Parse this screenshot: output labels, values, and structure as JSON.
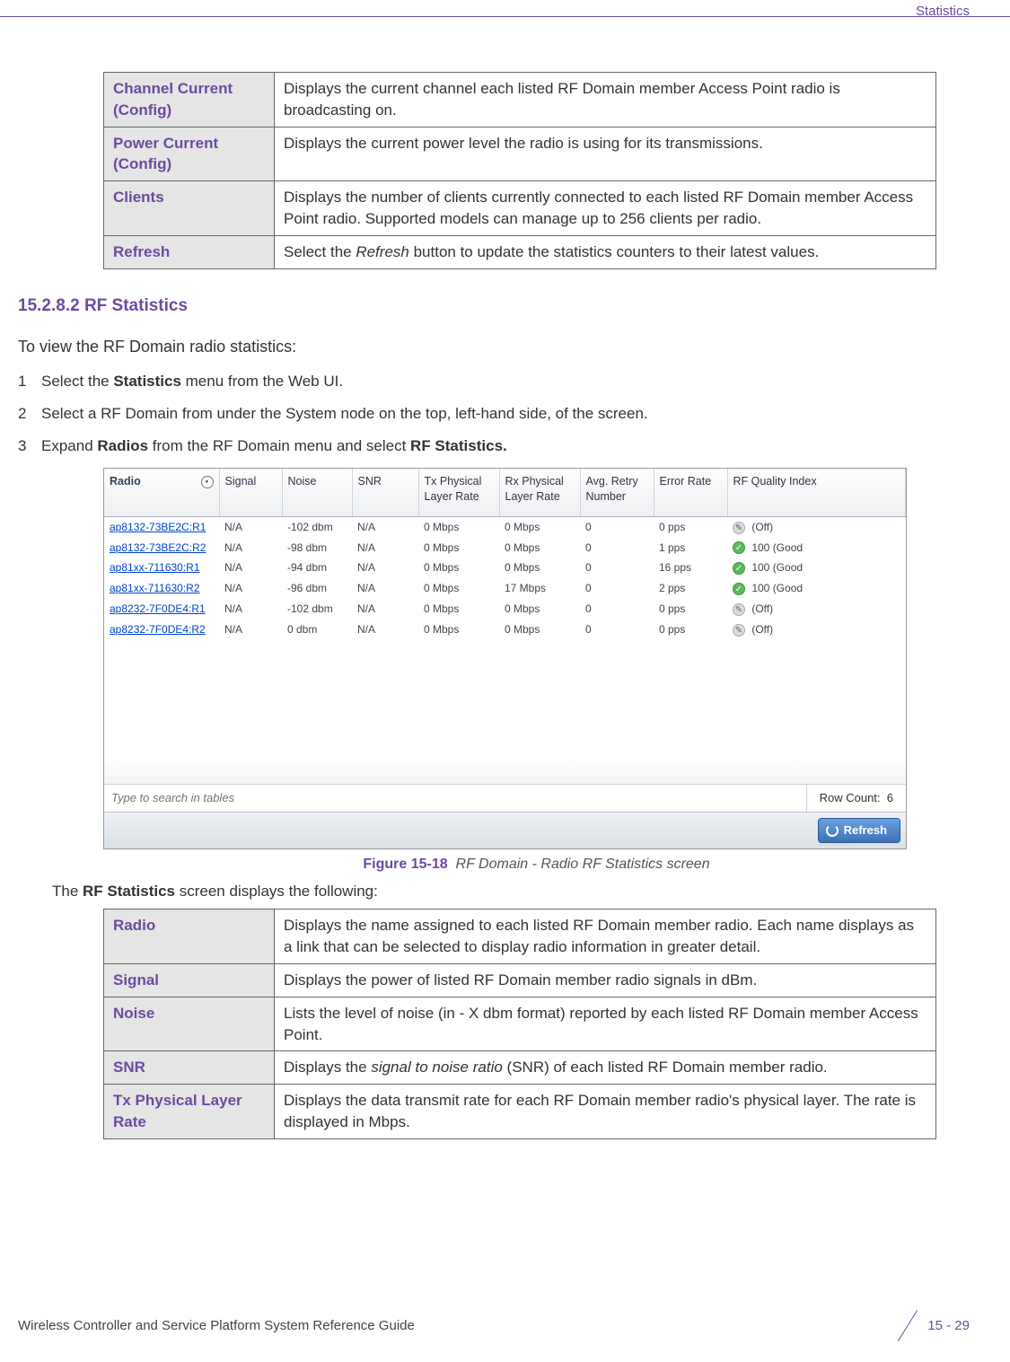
{
  "header": {
    "section_title": "Statistics"
  },
  "param_table1": [
    {
      "label": "Channel Current (Config)",
      "desc": "Displays the current channel each listed RF Domain member Access Point radio is broadcasting on."
    },
    {
      "label": "Power Current (Config)",
      "desc": "Displays the current power level the radio is using for its transmissions."
    },
    {
      "label": "Clients",
      "desc": "Displays the number of clients currently connected to each listed RF Domain member Access Point radio. Supported models can manage up to 256 clients per radio."
    },
    {
      "label": "Refresh",
      "desc_pre": "Select the ",
      "desc_em": "Refresh",
      "desc_post": " button to update the statistics counters to their latest values."
    }
  ],
  "section_heading": "15.2.8.2  RF Statistics",
  "intro": "To view the RF Domain radio statistics:",
  "steps": [
    {
      "n": "1",
      "pre": "Select the ",
      "b1": "Statistics",
      "post": " menu from the Web UI."
    },
    {
      "n": "2",
      "text": "Select a RF Domain from under the System node on the top, left-hand side, of the screen."
    },
    {
      "n": "3",
      "pre": "Expand ",
      "b1": "Radios",
      "mid": " from the RF Domain menu and select ",
      "b2": "RF Statistics."
    }
  ],
  "chart_data": {
    "type": "table",
    "columns": [
      "Radio",
      "Signal",
      "Noise",
      "SNR",
      "Tx Physical Layer Rate",
      "Rx Physical Layer Rate",
      "Avg. Retry Number",
      "Error Rate",
      "RF Quality Index"
    ],
    "rows": [
      {
        "radio": "ap8132-73BE2C:R1",
        "signal": "N/A",
        "noise": "-102 dbm",
        "snr": "N/A",
        "tx": "0 Mbps",
        "rx": "0 Mbps",
        "retry": "0",
        "err": "0 pps",
        "qi_icon": "off",
        "qi": "(Off)"
      },
      {
        "radio": "ap8132-73BE2C:R2",
        "signal": "N/A",
        "noise": "-98 dbm",
        "snr": "N/A",
        "tx": "0 Mbps",
        "rx": "0 Mbps",
        "retry": "0",
        "err": "1 pps",
        "qi_icon": "good",
        "qi": "100 (Good"
      },
      {
        "radio": "ap81xx-711630:R1",
        "signal": "N/A",
        "noise": "-94 dbm",
        "snr": "N/A",
        "tx": "0 Mbps",
        "rx": "0 Mbps",
        "retry": "0",
        "err": "16 pps",
        "qi_icon": "good",
        "qi": "100 (Good"
      },
      {
        "radio": "ap81xx-711630:R2",
        "signal": "N/A",
        "noise": "-96 dbm",
        "snr": "N/A",
        "tx": "0 Mbps",
        "rx": "17 Mbps",
        "retry": "0",
        "err": "2 pps",
        "qi_icon": "good",
        "qi": "100 (Good"
      },
      {
        "radio": "ap8232-7F0DE4:R1",
        "signal": "N/A",
        "noise": "-102 dbm",
        "snr": "N/A",
        "tx": "0 Mbps",
        "rx": "0 Mbps",
        "retry": "0",
        "err": "0 pps",
        "qi_icon": "off",
        "qi": "(Off)"
      },
      {
        "radio": "ap8232-7F0DE4:R2",
        "signal": "N/A",
        "noise": "0 dbm",
        "snr": "N/A",
        "tx": "0 Mbps",
        "rx": "0 Mbps",
        "retry": "0",
        "err": "0 pps",
        "qi_icon": "off",
        "qi": "(Off)"
      }
    ],
    "search_placeholder": "Type to search in tables",
    "row_count_label": "Row Count:",
    "row_count_value": "6",
    "refresh_label": "Refresh"
  },
  "figure_caption": {
    "prefix": "Figure 15-18",
    "text": "RF Domain - Radio RF Statistics screen"
  },
  "lead": {
    "pre": "The ",
    "b": "RF Statistics",
    "post": " screen displays the following:"
  },
  "param_table2": [
    {
      "label": "Radio",
      "desc": "Displays the name assigned to each listed RF Domain member radio. Each name displays as a link that can be selected to display radio information in greater detail."
    },
    {
      "label": "Signal",
      "desc": "Displays the power of listed RF Domain member radio signals in dBm."
    },
    {
      "label": "Noise",
      "desc": "Lists the level of noise (in - X dbm format) reported by each listed RF Domain member Access Point."
    },
    {
      "label": "SNR",
      "desc_pre": "Displays the ",
      "desc_em": "signal to noise ratio",
      "desc_post": " (SNR) of each listed RF Domain member radio."
    },
    {
      "label": "Tx Physical Layer Rate",
      "desc": "Displays the data transmit rate for each RF Domain member radio's physical layer. The rate is displayed in Mbps."
    }
  ],
  "footer": {
    "guide": "Wireless Controller and Service Platform System Reference Guide",
    "page": "15 - 29"
  }
}
